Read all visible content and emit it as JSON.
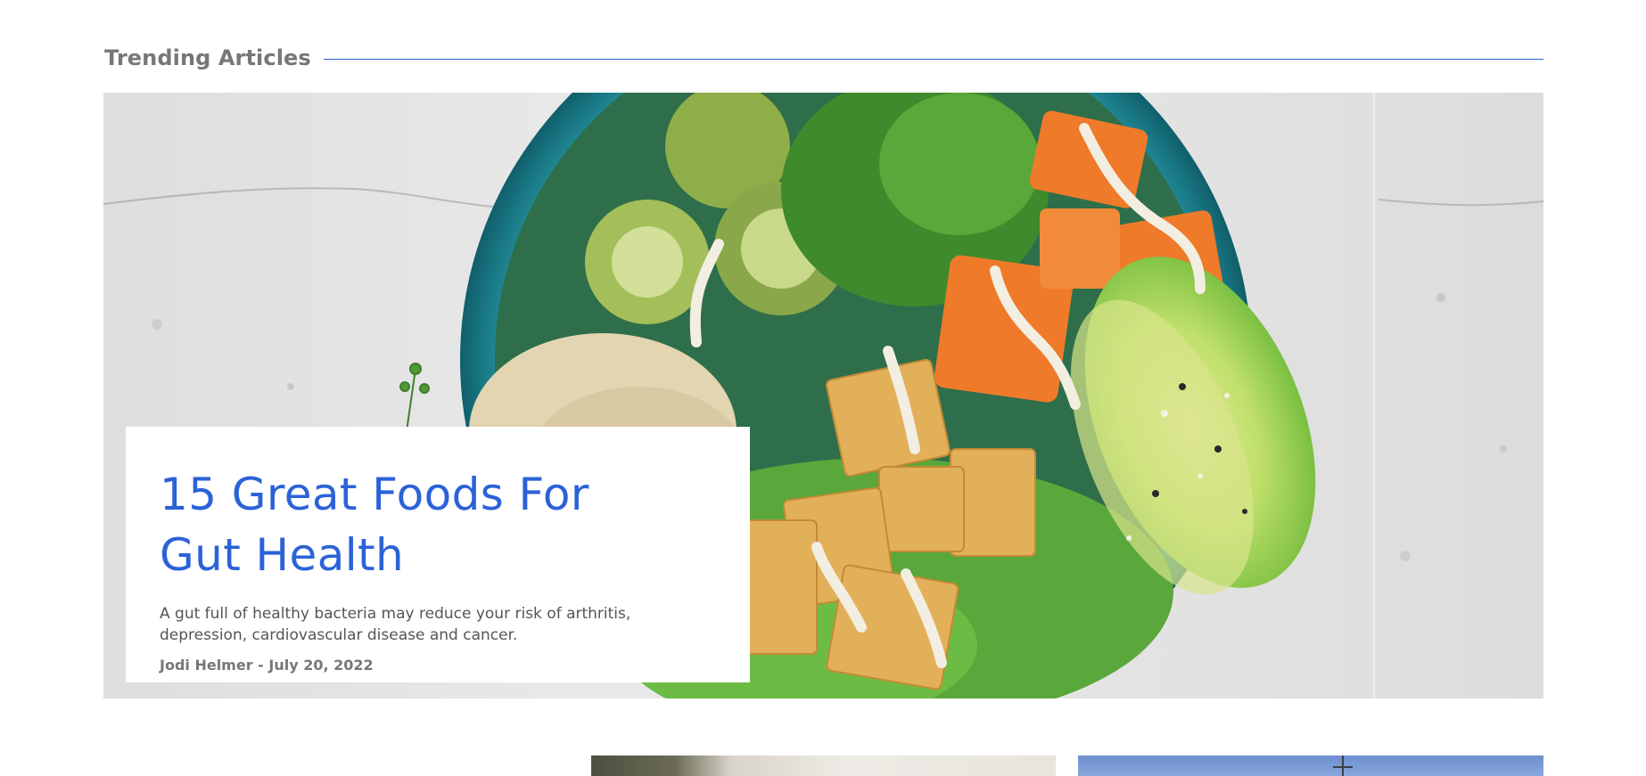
{
  "section": {
    "title": "Trending Articles"
  },
  "featured_article": {
    "title": "15 Great Foods For Gut Health",
    "summary": "A gut full of healthy bacteria may reduce your risk of arthritis, depression, cardiovascular disease and cancer.",
    "meta": "Jodi Helmer - July 20, 2022",
    "image_subject": "bowl of tofu, quinoa, avocado, sweet potato, brussels sprouts and microgreens"
  },
  "colors": {
    "accent": "#2b62d8",
    "heading_gray": "#777777",
    "body_text": "#555555",
    "bowl_teal": "#1f8a96"
  },
  "icons": {
    "hero_image": "food-bowl-image",
    "thumb_1": "article-thumbnail-image",
    "thumb_2": "article-thumbnail-image"
  }
}
